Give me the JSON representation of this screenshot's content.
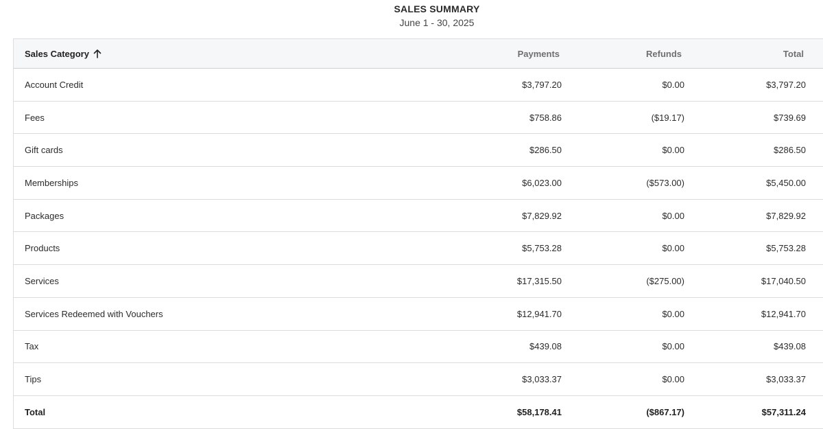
{
  "report": {
    "title": "SALES SUMMARY",
    "date_range": "June 1 - 30, 2025"
  },
  "table": {
    "columns": {
      "category": "Sales Category",
      "payments": "Payments",
      "refunds": "Refunds",
      "total": "Total"
    },
    "sort_icon": "arrow-up-icon",
    "rows": [
      {
        "category": "Account Credit",
        "payments": "$3,797.20",
        "refunds": "$0.00",
        "total": "$3,797.20"
      },
      {
        "category": "Fees",
        "payments": "$758.86",
        "refunds": "($19.17)",
        "total": "$739.69"
      },
      {
        "category": "Gift cards",
        "payments": "$286.50",
        "refunds": "$0.00",
        "total": "$286.50"
      },
      {
        "category": "Memberships",
        "payments": "$6,023.00",
        "refunds": "($573.00)",
        "total": "$5,450.00"
      },
      {
        "category": "Packages",
        "payments": "$7,829.92",
        "refunds": "$0.00",
        "total": "$7,829.92"
      },
      {
        "category": "Products",
        "payments": "$5,753.28",
        "refunds": "$0.00",
        "total": "$5,753.28"
      },
      {
        "category": "Services",
        "payments": "$17,315.50",
        "refunds": "($275.00)",
        "total": "$17,040.50"
      },
      {
        "category": "Services Redeemed with Vouchers",
        "payments": "$12,941.70",
        "refunds": "$0.00",
        "total": "$12,941.70"
      },
      {
        "category": "Tax",
        "payments": "$439.08",
        "refunds": "$0.00",
        "total": "$439.08"
      },
      {
        "category": "Tips",
        "payments": "$3,033.37",
        "refunds": "$0.00",
        "total": "$3,033.37"
      }
    ],
    "total_row": {
      "category": "Total",
      "payments": "$58,178.41",
      "refunds": "($867.17)",
      "total": "$57,311.24"
    }
  }
}
